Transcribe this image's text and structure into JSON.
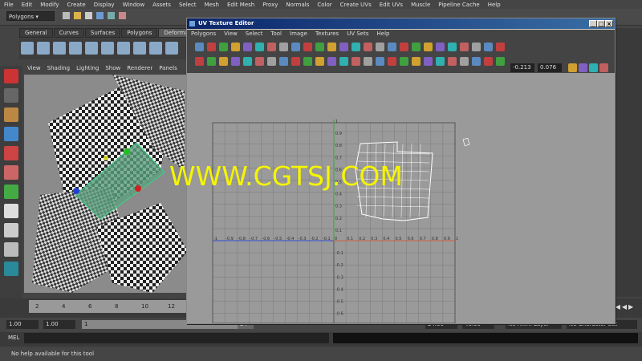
{
  "main_menu": [
    "File",
    "Edit",
    "Modify",
    "Create",
    "Display",
    "Window",
    "Assets",
    "Select",
    "Mesh",
    "Edit Mesh",
    "Proxy",
    "Normals",
    "Color",
    "Create UVs",
    "Edit UVs",
    "Muscle",
    "Pipeline Cache",
    "Help"
  ],
  "mode_selector": "Polygons",
  "shelf_tabs": [
    "General",
    "Curves",
    "Surfaces",
    "Polygons",
    "Deformation"
  ],
  "active_shelf_tab": "Deformation",
  "viewport_menu": [
    "View",
    "Shading",
    "Lighting",
    "Show",
    "Renderer",
    "Panels"
  ],
  "uv_window": {
    "title": "UV Texture Editor",
    "menu": [
      "Polygons",
      "View",
      "Select",
      "Tool",
      "Image",
      "Textures",
      "UV Sets",
      "Help"
    ],
    "u_field": "-0.213",
    "v_field": "0.076",
    "axis_labels_x": [
      "-1",
      "-0.9",
      "-0.8",
      "-0.7",
      "-0.6",
      "-0.5",
      "-0.4",
      "-0.3",
      "-0.2",
      "-0.1",
      "0",
      "0.1",
      "0.2",
      "0.3",
      "0.4",
      "0.5",
      "0.6",
      "0.7",
      "0.8",
      "0.9",
      "1"
    ],
    "axis_labels_y_pos": [
      "1",
      "0.9",
      "0.8",
      "0.7",
      "0.6",
      "0.5",
      "0.4",
      "0.3",
      "0.2",
      "0.1"
    ],
    "axis_labels_y_neg": [
      "-0.1",
      "-0.2",
      "-0.3",
      "-0.4",
      "-0.5",
      "-0.6"
    ]
  },
  "watermark": "WWW.CGTSJ.COM",
  "timeline_ticks": [
    "2",
    "4",
    "6",
    "8",
    "10",
    "12"
  ],
  "range": {
    "start": "1.00",
    "playback_start": "1.00",
    "frame": "1",
    "mid": "24",
    "end1": "24.00",
    "end2": "48.00",
    "anim_layer": "No Anim Layer",
    "char_set": "No Character Set"
  },
  "command_label": "MEL",
  "help_text": "No help available for this tool",
  "colors": {
    "maya_bg": "#444444",
    "uv_grid": "#9a9a9a",
    "title_bar": "#0a246a",
    "watermark": "#f5f500",
    "u_axis": "#3050d0",
    "v_axis": "#30b030"
  }
}
